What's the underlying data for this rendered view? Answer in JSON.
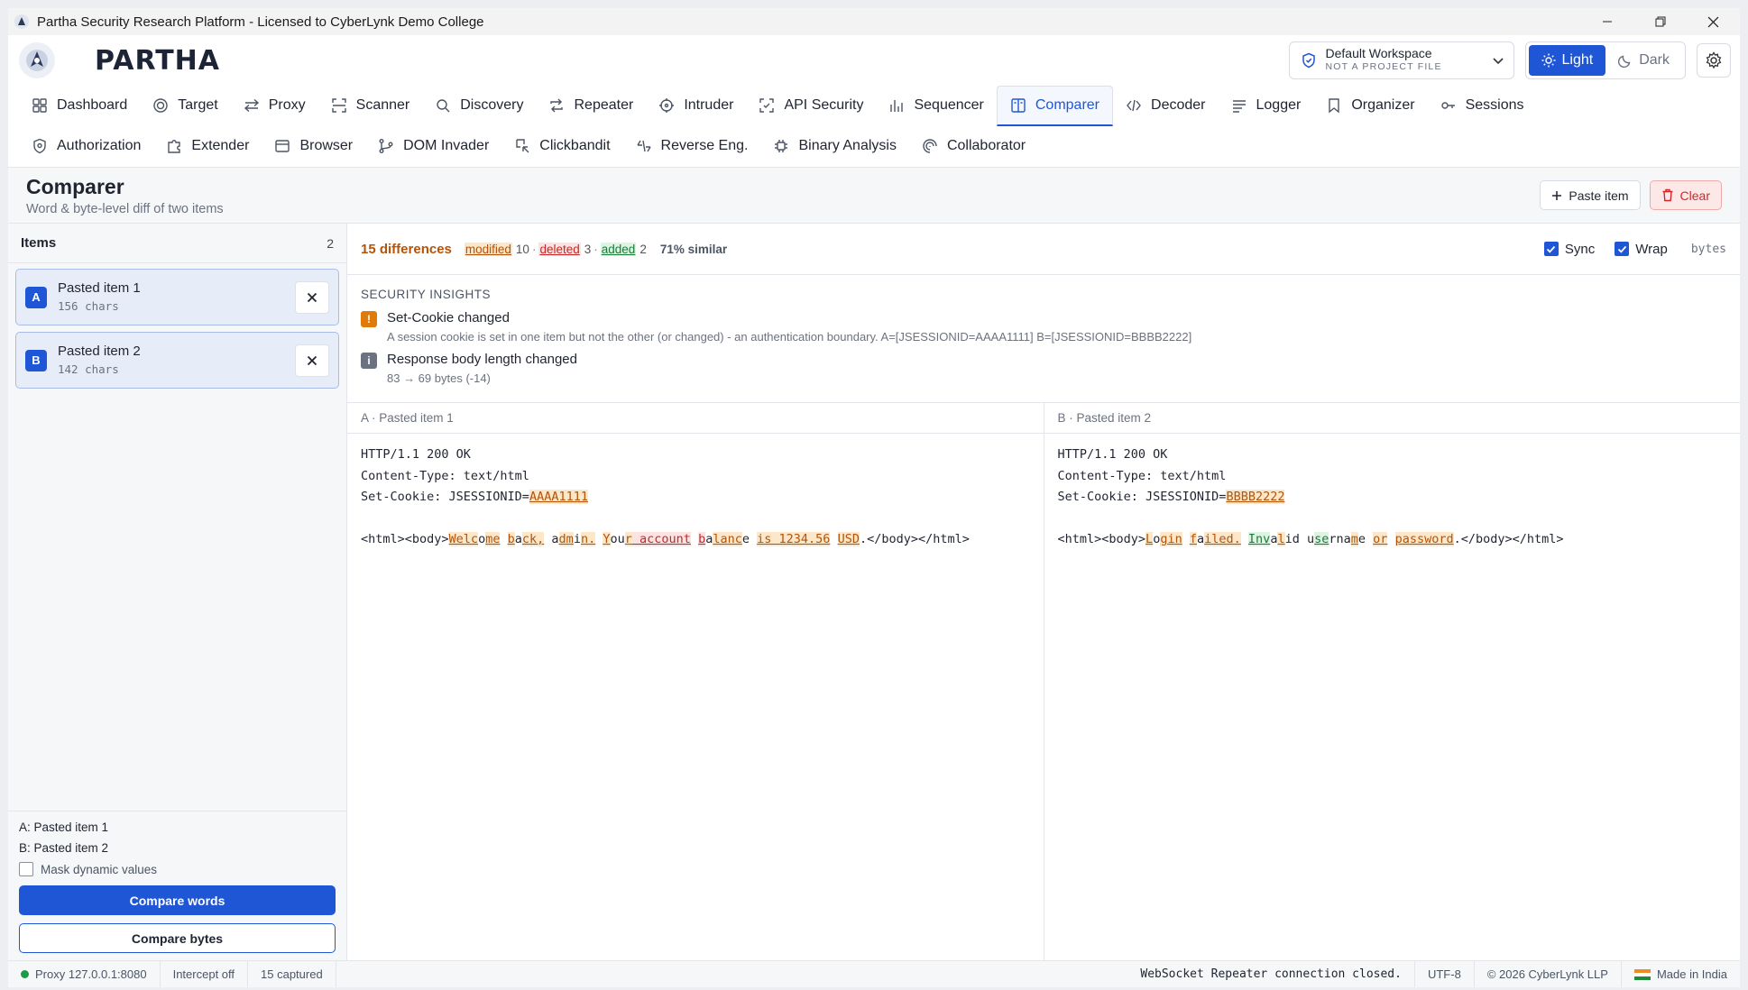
{
  "window": {
    "title": "Partha Security Research Platform - Licensed to CyberLynk Demo College"
  },
  "header": {
    "logo_text": "PARTHA",
    "workspace_name": "Default Workspace",
    "workspace_sub": "NOT A PROJECT FILE",
    "theme_light": "Light",
    "theme_dark": "Dark"
  },
  "tabs_row1": [
    {
      "label": "Dashboard",
      "icon": "dashboard-icon"
    },
    {
      "label": "Target",
      "icon": "target-icon"
    },
    {
      "label": "Proxy",
      "icon": "proxy-icon"
    },
    {
      "label": "Scanner",
      "icon": "scanner-icon"
    },
    {
      "label": "Discovery",
      "icon": "search-icon"
    },
    {
      "label": "Repeater",
      "icon": "repeat-icon"
    },
    {
      "label": "Intruder",
      "icon": "crosshair-icon"
    },
    {
      "label": "API Security",
      "icon": "api-icon"
    },
    {
      "label": "Sequencer",
      "icon": "bar-chart-icon"
    },
    {
      "label": "Comparer",
      "icon": "columns-icon",
      "active": true
    },
    {
      "label": "Decoder",
      "icon": "code-icon"
    },
    {
      "label": "Logger",
      "icon": "list-icon"
    },
    {
      "label": "Organizer",
      "icon": "bookmark-icon"
    },
    {
      "label": "Sessions",
      "icon": "key-icon"
    }
  ],
  "tabs_row2": [
    {
      "label": "Authorization",
      "icon": "shield-icon"
    },
    {
      "label": "Extender",
      "icon": "puzzle-icon"
    },
    {
      "label": "Browser",
      "icon": "browser-icon"
    },
    {
      "label": "DOM Invader",
      "icon": "branch-icon"
    },
    {
      "label": "Clickbandit",
      "icon": "cursor-icon"
    },
    {
      "label": "Reverse Eng.",
      "icon": "reverse-icon"
    },
    {
      "label": "Binary Analysis",
      "icon": "chip-icon"
    },
    {
      "label": "Collaborator",
      "icon": "radar-icon"
    }
  ],
  "page": {
    "title": "Comparer",
    "subtitle": "Word & byte-level diff of two items",
    "paste_label": "Paste item",
    "clear_label": "Clear"
  },
  "sidebar": {
    "title": "Items",
    "count": "2",
    "items": [
      {
        "badge": "A",
        "name": "Pasted item 1",
        "size": "156 chars"
      },
      {
        "badge": "B",
        "name": "Pasted item 2",
        "size": "142 chars"
      }
    ],
    "legend_a": "A: Pasted item 1",
    "legend_b": "B: Pasted item 2",
    "mask_label": "Mask dynamic values",
    "compare_words": "Compare words",
    "compare_bytes": "Compare bytes"
  },
  "summary": {
    "differences": "15 differences",
    "modified_label": "modified",
    "modified_count": "10",
    "deleted_label": "deleted",
    "deleted_count": "3",
    "added_label": "added",
    "added_count": "2",
    "sep": "·",
    "similar": "71% similar",
    "sync_label": "Sync",
    "wrap_label": "Wrap",
    "bytes_label": "bytes"
  },
  "insights": {
    "title": "SECURITY INSIGHTS",
    "items": [
      {
        "icon": "!",
        "title": "Set-Cookie changed",
        "detail": "A session cookie is set in one item but not the other (or changed) - an authentication boundary. A=[JSESSIONID=AAAA1111] B=[JSESSIONID=BBBB2222]"
      },
      {
        "icon": "i",
        "title": "Response body length changed",
        "detail": "83 → 69 bytes (-14)"
      }
    ]
  },
  "panes": {
    "a_title": "A · Pasted item 1",
    "b_title": "B · Pasted item 2",
    "a_lines": [
      [
        {
          "t": "HTTP/1.1 200 OK"
        }
      ],
      [
        {
          "t": "Content-Type: text/html"
        }
      ],
      [
        {
          "t": "Set-Cookie: JSESSIONID="
        },
        {
          "t": "AAAA1111",
          "k": "m"
        }
      ],
      [],
      [
        {
          "t": "<html><body>"
        },
        {
          "t": "Welc",
          "k": "m"
        },
        {
          "t": "o"
        },
        {
          "t": "me",
          "k": "m"
        },
        {
          "t": " "
        },
        {
          "t": "b",
          "k": "m"
        },
        {
          "t": "a"
        },
        {
          "t": "ck,",
          "k": "m"
        },
        {
          "t": " a"
        },
        {
          "t": "dm",
          "k": "m"
        },
        {
          "t": "i"
        },
        {
          "t": "n.",
          "k": "m"
        },
        {
          "t": " "
        },
        {
          "t": "Y",
          "k": "m"
        },
        {
          "t": "ou"
        },
        {
          "t": "r",
          "k": "m"
        },
        {
          "t": " account",
          "k": "d"
        },
        {
          "t": " "
        },
        {
          "t": "b",
          "k": "d"
        },
        {
          "t": "a"
        },
        {
          "t": "lanc",
          "k": "m"
        },
        {
          "t": "e "
        },
        {
          "t": "is 1234.56",
          "k": "m"
        },
        {
          "t": " "
        },
        {
          "t": "USD",
          "k": "m"
        },
        {
          "t": ".</body></html>"
        }
      ]
    ],
    "b_lines": [
      [
        {
          "t": "HTTP/1.1 200 OK"
        }
      ],
      [
        {
          "t": "Content-Type: text/html"
        }
      ],
      [
        {
          "t": "Set-Cookie: JSESSIONID="
        },
        {
          "t": "BBBB2222",
          "k": "m"
        }
      ],
      [],
      [
        {
          "t": "<html><body>"
        },
        {
          "t": "L",
          "k": "m"
        },
        {
          "t": "o"
        },
        {
          "t": "gin",
          "k": "m"
        },
        {
          "t": " "
        },
        {
          "t": "f",
          "k": "m"
        },
        {
          "t": "a"
        },
        {
          "t": "iled.",
          "k": "m"
        },
        {
          "t": " "
        },
        {
          "t": "Inv",
          "k": "a"
        },
        {
          "t": "a"
        },
        {
          "t": "l",
          "k": "m"
        },
        {
          "t": "id u"
        },
        {
          "t": "se",
          "k": "a"
        },
        {
          "t": "rna"
        },
        {
          "t": "m",
          "k": "m"
        },
        {
          "t": "e "
        },
        {
          "t": "or",
          "k": "m"
        },
        {
          "t": " "
        },
        {
          "t": "password",
          "k": "m"
        },
        {
          "t": ".</body></html>"
        }
      ]
    ]
  },
  "statusbar": {
    "proxy": "Proxy 127.0.0.1:8080",
    "intercept": "Intercept off",
    "captured": "15 captured",
    "message": "WebSocket Repeater connection closed.",
    "encoding": "UTF-8",
    "copyright": "© 2026 CyberLynk LLP",
    "made_in": "Made in India"
  },
  "colors": {
    "accent": "#1f56d6",
    "modified": "#b45309",
    "deleted": "#c62828",
    "added": "#1e7a3a",
    "danger": "#d02828"
  }
}
